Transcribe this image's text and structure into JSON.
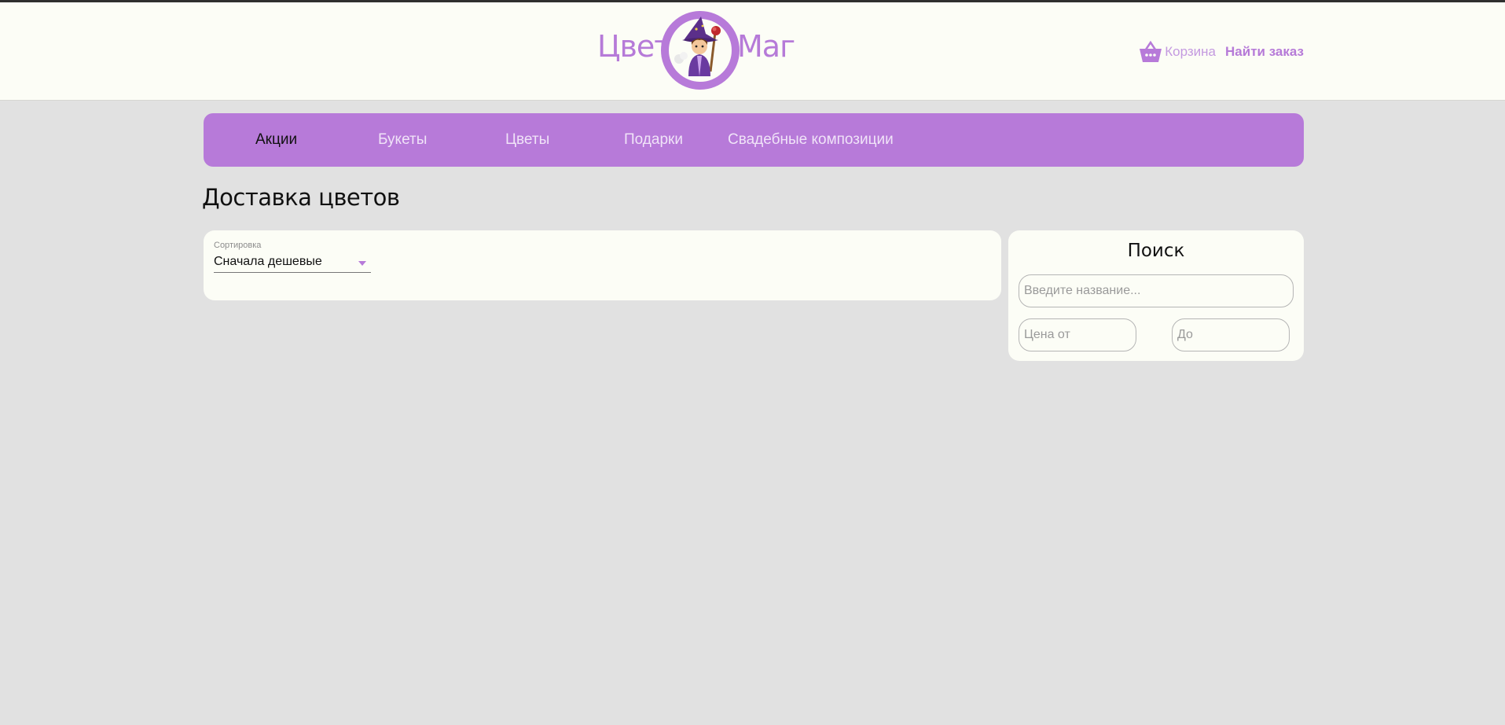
{
  "header": {
    "logo_left": "Цвет",
    "logo_right": "Маг",
    "cart_label": "Корзина",
    "find_order_label": "Найти заказ"
  },
  "nav": {
    "items": [
      {
        "label": "Акции",
        "active": true
      },
      {
        "label": "Букеты",
        "active": false
      },
      {
        "label": "Цветы",
        "active": false
      },
      {
        "label": "Подарки",
        "active": false
      },
      {
        "label": "Свадебные композиции",
        "active": false
      }
    ]
  },
  "page": {
    "title": "Доставка цветов"
  },
  "sort": {
    "label": "Сортировка",
    "value": "Сначала дешевые"
  },
  "search": {
    "title": "Поиск",
    "name_placeholder": "Введите название...",
    "price_from_placeholder": "Цена от",
    "price_to_placeholder": "До"
  },
  "colors": {
    "accent": "#b77ad9",
    "header_bg": "#fcfdf6",
    "page_bg": "#e1e1e1"
  },
  "icons": {
    "cart": "basket-icon",
    "logo": "wizard-logo-icon",
    "sort": "chevron-down-icon"
  }
}
